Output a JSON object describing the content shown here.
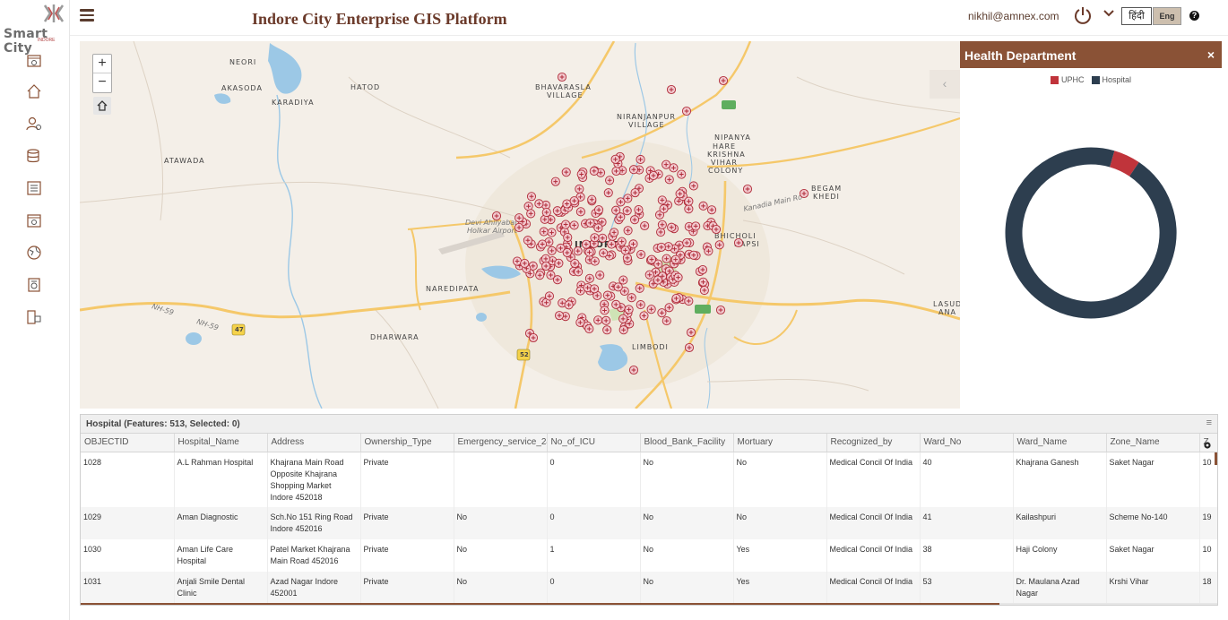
{
  "logo": {
    "text": "Smart City",
    "subtext": "INDORE"
  },
  "header": {
    "title": "Indore City Enterprise GIS Platform",
    "user_email": "nikhil@amnex.com",
    "lang_hindi": "हिंदी",
    "lang_english": "Eng",
    "help": "?"
  },
  "sidebar": {
    "items": [
      {
        "icon": "dashboard-icon"
      },
      {
        "icon": "home-icon"
      },
      {
        "icon": "user-settings-icon"
      },
      {
        "icon": "database-icon"
      },
      {
        "icon": "list-icon"
      },
      {
        "icon": "calendar-icon"
      },
      {
        "icon": "globe-icon"
      },
      {
        "icon": "report-icon"
      },
      {
        "icon": "device-icon"
      }
    ]
  },
  "map": {
    "zoom_in": "+",
    "zoom_out": "−",
    "collapse": "‹",
    "labels": {
      "neori": "NEORI",
      "akasoda": "AKASODA",
      "hatod": "HATOD",
      "karadiya": "KARADIYA",
      "atawada": "ATAWADA",
      "bhavarasla": "BHAVARASLA",
      "village1": "VILLAGE",
      "niranjanpur": "NIRANJANPUR",
      "village2": "VILLAGE",
      "nipanya": "NIPANYA",
      "hare": "HARE",
      "krishna": "KRISHNA",
      "vihar": "VIHAR",
      "colony": "COLONY",
      "begam": "BEGAM",
      "khedi": "KHEDI",
      "kanadia": "Kanadia Main Ro",
      "bhicholi": "BHICHOLI",
      "hapsi": "HAPSI",
      "indore": "INDORE",
      "airport1": "Devi Ahilyabai",
      "airport2": "Holkar Airport",
      "naredipata": "NAREDIPATA",
      "dharwara": "DHARWARA",
      "limbodi": "LIMBODI",
      "lasud": "LASUD",
      "ana": "ANA",
      "nh59a": "NH-59",
      "nh59b": "NH-59",
      "shield47": "47",
      "shield52": "52"
    }
  },
  "panel": {
    "title": "Health Department",
    "close": "×",
    "legend": [
      {
        "label": "UPHC",
        "color": "#c0343b"
      },
      {
        "label": "Hospital",
        "color": "#2d3e4f"
      }
    ]
  },
  "chart_data": {
    "type": "pie",
    "title": "",
    "labels": [
      "UPHC",
      "Hospital"
    ],
    "values": [
      26,
      487
    ],
    "colors": [
      "#c0343b",
      "#2d3e4f"
    ],
    "donut": true
  },
  "grid": {
    "title": "Hospital (Features: 513, Selected: 0)",
    "menu": "≡",
    "columns": [
      "OBJECTID",
      "Hospital_Name",
      "Address",
      "Ownership_Type",
      "Emergency_service_24",
      "No_of_ICU",
      "Blood_Bank_Facility",
      "Mortuary",
      "Recognized_by",
      "Ward_No",
      "Ward_Name",
      "Zone_Name",
      "Z"
    ],
    "rows": [
      [
        "1028",
        "A.L Rahman Hospital",
        "Khajrana Main Road Opposite Khajrana Shopping Market Indore 452018",
        "Private",
        "",
        "0",
        "No",
        "No",
        "Medical Concil Of India",
        "40",
        "Khajrana Ganesh",
        "Saket Nagar",
        "10"
      ],
      [
        "1029",
        "Aman Diagnostic",
        "Sch.No 151 Ring Road Indore 452016",
        "Private",
        "No",
        "0",
        "No",
        "No",
        "Medical Concil Of India",
        "41",
        "Kailashpuri",
        "Scheme No-140",
        "19"
      ],
      [
        "1030",
        "Aman Life Care Hospital",
        "Patel Market Khajrana Main Road 452016",
        "Private",
        "No",
        "1",
        "No",
        "Yes",
        "Medical Concil Of India",
        "38",
        "Haji Colony",
        "Saket Nagar",
        "10"
      ],
      [
        "1031",
        "Anjali Smile Dental Clinic",
        "Azad Nagar Indore 452001",
        "Private",
        "No",
        "0",
        "No",
        "Yes",
        "Medical Concil Of India",
        "53",
        "Dr. Maulana Azad Nagar",
        "Krshi Vihar",
        "18"
      ]
    ]
  }
}
